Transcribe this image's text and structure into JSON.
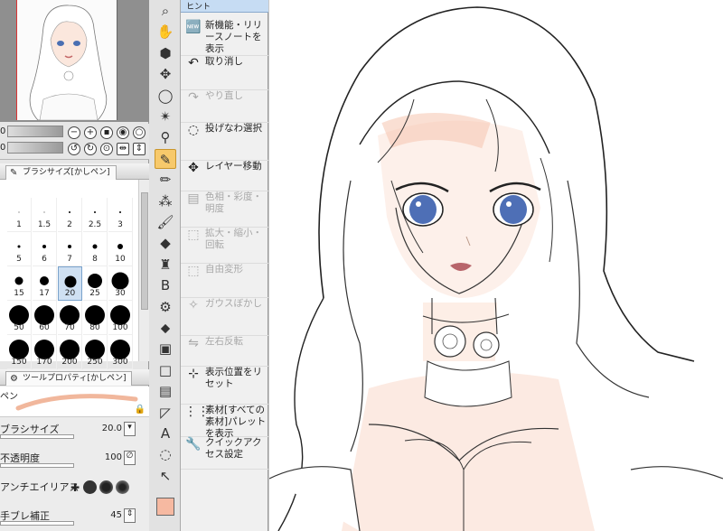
{
  "navigator": {
    "row1_value": "0",
    "row2_value": "0"
  },
  "brush_size_panel": {
    "tab_label": "ブラシサイズ[かしペン]",
    "cells": [
      {
        "label": "1",
        "size": 1
      },
      {
        "label": "1.5",
        "size": 1
      },
      {
        "label": "2",
        "size": 2
      },
      {
        "label": "2.5",
        "size": 2
      },
      {
        "label": "3",
        "size": 2
      },
      {
        "label": "5",
        "size": 3
      },
      {
        "label": "6",
        "size": 4
      },
      {
        "label": "7",
        "size": 4
      },
      {
        "label": "8",
        "size": 5
      },
      {
        "label": "10",
        "size": 6
      },
      {
        "label": "15",
        "size": 9
      },
      {
        "label": "17",
        "size": 10
      },
      {
        "label": "20",
        "size": 13
      },
      {
        "label": "25",
        "size": 16
      },
      {
        "label": "30",
        "size": 19
      },
      {
        "label": "50",
        "size": 22
      },
      {
        "label": "60",
        "size": 22
      },
      {
        "label": "70",
        "size": 22
      },
      {
        "label": "80",
        "size": 22
      },
      {
        "label": "100",
        "size": 22
      },
      {
        "label": "150",
        "size": 22
      },
      {
        "label": "170",
        "size": 22
      },
      {
        "label": "200",
        "size": 22
      },
      {
        "label": "250",
        "size": 22
      },
      {
        "label": "300",
        "size": 22
      }
    ],
    "selected": "20"
  },
  "tool_property": {
    "tab_label": "ツールプロパティ[かしペン]",
    "preview_label": "ペン",
    "brush_size_label": "ブラシサイズ",
    "brush_size_value": "20.0",
    "opacity_label": "不透明度",
    "opacity_value": "100",
    "antialias_label": "アンチエイリアス",
    "stabilize_label": "手ブレ補正",
    "stabilize_value": "45"
  },
  "toolbar": {
    "tools": [
      "zoom-icon",
      "hand-icon",
      "rotate-icon",
      "move-icon",
      "lasso-icon",
      "magic-wand-icon",
      "eyedropper-icon",
      "pen-icon",
      "pencil-icon",
      "airbrush-icon",
      "brush-icon",
      "eraser-icon",
      "stamp-icon",
      "blend-icon",
      "gear-icon",
      "fill-icon",
      "gradient-icon",
      "square-icon",
      "frame-icon",
      "ruler-icon",
      "text-icon",
      "balloon-icon",
      "select-icon"
    ],
    "selected": "pen-icon",
    "main_color": "#f6b9a1"
  },
  "command_bar": {
    "top_label": "ヒント",
    "items": [
      {
        "icon": "new-icon",
        "label": "新機能・リリースノートを表示",
        "disabled": false
      },
      {
        "icon": "undo-icon",
        "label": "取り消し",
        "disabled": false
      },
      {
        "icon": "redo-icon",
        "label": "やり直し",
        "disabled": true
      },
      {
        "icon": "lasso-select-icon",
        "label": "投げなわ選択",
        "disabled": false
      },
      {
        "icon": "move-layer-icon",
        "label": "レイヤー移動",
        "disabled": false
      },
      {
        "icon": "hsl-icon",
        "label": "色相・彩度・明度",
        "disabled": true
      },
      {
        "icon": "scale-icon",
        "label": "拡大・縮小・回転",
        "disabled": true
      },
      {
        "icon": "free-transform-icon",
        "label": "自由変形",
        "disabled": true
      },
      {
        "icon": "blur-icon",
        "label": "ガウスぼかし",
        "disabled": true
      },
      {
        "icon": "flip-icon",
        "label": "左右反転",
        "disabled": true
      },
      {
        "icon": "reset-view-icon",
        "label": "表示位置をリセット",
        "disabled": false
      },
      {
        "icon": "material-icon",
        "label": "素材[すべての素材]パレットを表示",
        "disabled": false
      },
      {
        "icon": "wrench-icon",
        "label": "クイックアクセス設定",
        "disabled": false
      }
    ]
  }
}
